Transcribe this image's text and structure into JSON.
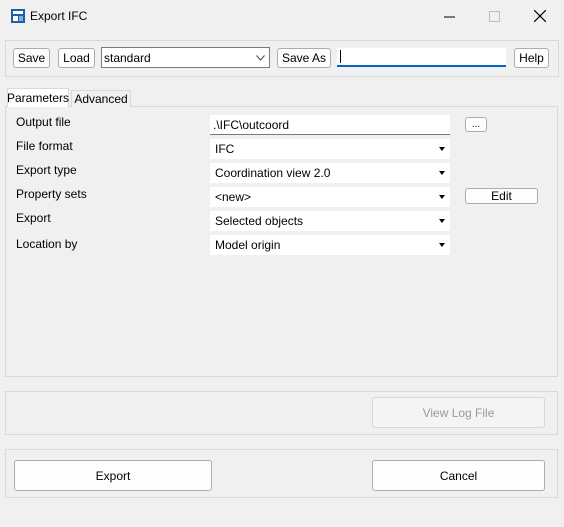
{
  "window": {
    "title": "Export IFC"
  },
  "toolbar": {
    "save_label": "Save",
    "load_label": "Load",
    "setting_value": "standard",
    "save_as_label": "Save As",
    "name_value": "",
    "help_label": "Help"
  },
  "tabs": [
    {
      "label": "Parameters",
      "selected": true
    },
    {
      "label": "Advanced",
      "selected": false
    }
  ],
  "parameters": {
    "output_file": {
      "label": "Output file",
      "value": ".\\IFC\\outcoord",
      "browse_label": "..."
    },
    "file_format": {
      "label": "File format",
      "value": "IFC"
    },
    "export_type": {
      "label": "Export type",
      "value": "Coordination view 2.0"
    },
    "property_sets": {
      "label": "Property sets",
      "value": "<new>",
      "edit_label": "Edit"
    },
    "export": {
      "label": "Export",
      "value": "Selected objects"
    },
    "location_by": {
      "label": "Location by",
      "value": "Model origin"
    }
  },
  "view_log_label": "View Log File",
  "export_label": "Export",
  "cancel_label": "Cancel",
  "colors": {
    "accent": "#0067c0",
    "window_bg": "#f0f0f0"
  }
}
